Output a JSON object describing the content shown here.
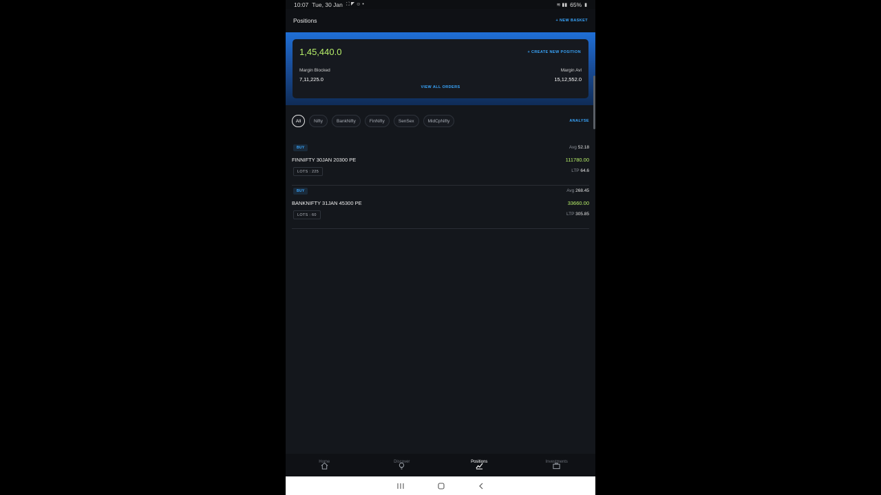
{
  "status_bar": {
    "time": "10:07",
    "date": "Tue, 30 Jan",
    "battery": "65%"
  },
  "header": {
    "title": "Positions",
    "new_basket": "+ NEW BASKET"
  },
  "summary": {
    "total_pnl": "1,45,440.0",
    "create_position": "+ CREATE NEW POSITION",
    "margin_blocked_label": "Margin Blocked",
    "margin_blocked_value": "7,11,225.0",
    "margin_avl_label": "Margin Avl",
    "margin_avl_value": "15,12,552.0",
    "view_all_orders": "VIEW ALL ORDERS"
  },
  "filters": {
    "chips": [
      "All",
      "Nifty",
      "BankNifty",
      "FinNifty",
      "SenSex",
      "MidCpNifty"
    ],
    "active": "All",
    "analyse": "ANALYSE"
  },
  "positions": [
    {
      "side": "BUY",
      "symbol": "FINNIFTY 30JAN 20300 PE",
      "lots": "LOTS : 225",
      "avg_label": "Avg",
      "avg": "52.18",
      "pnl": "111780.00",
      "ltp_label": "LTP",
      "ltp": "64.6"
    },
    {
      "side": "BUY",
      "symbol": "BANKNIFTY 31JAN 45300 PE",
      "lots": "LOTS : 60",
      "avg_label": "Avg",
      "avg": "268.45",
      "pnl": "33660.00",
      "ltp_label": "LTP",
      "ltp": "305.85"
    }
  ],
  "bottom_nav": [
    {
      "label": "Home",
      "icon": "home-icon"
    },
    {
      "label": "Discover",
      "icon": "bulb-icon"
    },
    {
      "label": "Positions",
      "icon": "chart-icon",
      "active": true
    },
    {
      "label": "Investments",
      "icon": "briefcase-icon"
    }
  ],
  "colors": {
    "accent": "#3aa7ff",
    "profit": "#b8f06a",
    "background": "#14171c"
  }
}
